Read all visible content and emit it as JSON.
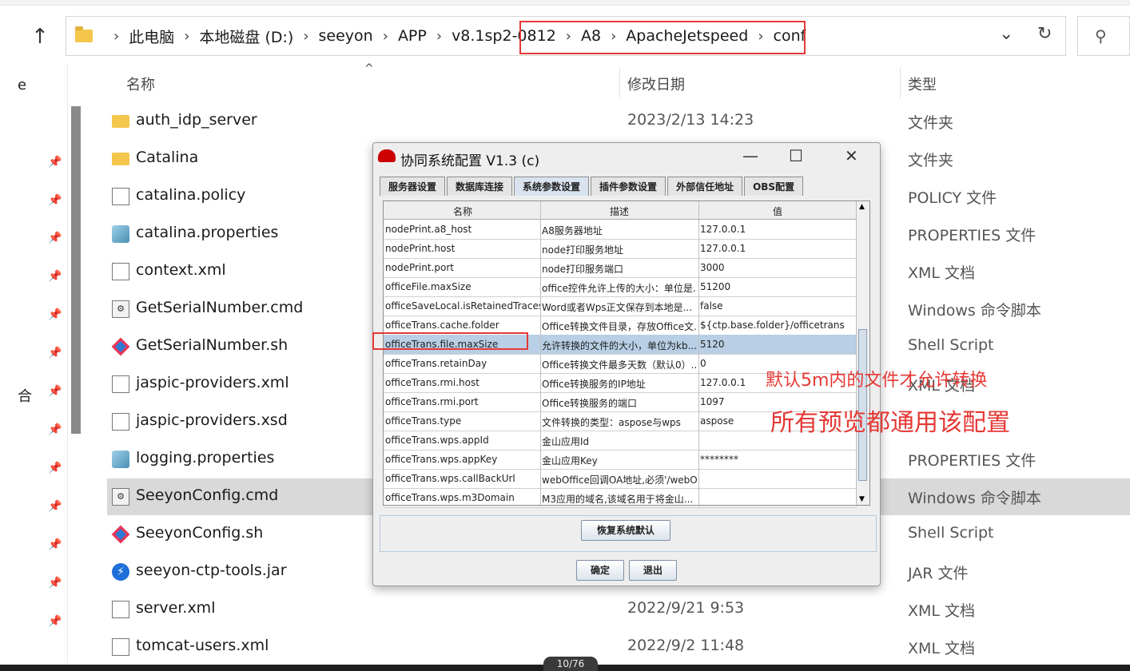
{
  "explorer": {
    "breadcrumbs": [
      "此电脑",
      "本地磁盘 (D:)",
      "seeyon",
      "APP",
      "v8.1sp2-0812",
      "A8",
      "ApacheJetspeed",
      "conf"
    ],
    "left_partial": [
      "e",
      "合"
    ],
    "columns": {
      "name": "名称",
      "date": "修改日期",
      "type": "类型"
    },
    "files": [
      {
        "name": "auth_idp_server",
        "date": "2023/2/13 14:23",
        "type": "文件夹",
        "icon": "folder-icon"
      },
      {
        "name": "Catalina",
        "date": "",
        "type": "文件夹",
        "icon": "folder-icon"
      },
      {
        "name": "catalina.policy",
        "date": "",
        "type": "POLICY 文件",
        "icon": "file-icon"
      },
      {
        "name": "catalina.properties",
        "date": "",
        "type": "PROPERTIES 文件",
        "icon": "properties-file-icon"
      },
      {
        "name": "context.xml",
        "date": "",
        "type": "XML 文档",
        "icon": "file-icon"
      },
      {
        "name": "GetSerialNumber.cmd",
        "date": "",
        "type": "Windows 命令脚本",
        "icon": "cmd-file-icon"
      },
      {
        "name": "GetSerialNumber.sh",
        "date": "",
        "type": "Shell Script",
        "icon": "shell-script-icon"
      },
      {
        "name": "jaspic-providers.xml",
        "date": "",
        "type": "XML 文档",
        "icon": "file-icon"
      },
      {
        "name": "jaspic-providers.xsd",
        "date": "",
        "type": "",
        "icon": "file-icon"
      },
      {
        "name": "logging.properties",
        "date": "",
        "type": "PROPERTIES 文件",
        "icon": "properties-file-icon"
      },
      {
        "name": "SeeyonConfig.cmd",
        "date": "",
        "type": "Windows 命令脚本",
        "icon": "cmd-file-icon",
        "selected": true
      },
      {
        "name": "SeeyonConfig.sh",
        "date": "",
        "type": "Shell Script",
        "icon": "shell-script-icon"
      },
      {
        "name": "seeyon-ctp-tools.jar",
        "date": "",
        "type": "JAR 文件",
        "icon": "jar-file-icon"
      },
      {
        "name": "server.xml",
        "date": "2022/9/21 9:53",
        "type": "XML 文档",
        "icon": "file-icon"
      },
      {
        "name": "tomcat-users.xml",
        "date": "2022/9/2 11:48",
        "type": "XML 文档",
        "icon": "file-icon"
      }
    ]
  },
  "dialog": {
    "title": "协同系统配置 V1.3 (c)",
    "tabs": [
      "服务器设置",
      "数据库连接",
      "系统参数设置",
      "插件参数设置",
      "外部信任地址",
      "OBS配置"
    ],
    "active_tab": "系统参数设置",
    "table_headers": [
      "名称",
      "描述",
      "值"
    ],
    "rows": [
      [
        "nodePrint.a8_host",
        "A8服务器地址",
        "127.0.0.1"
      ],
      [
        "nodePrint.host",
        "node打印服务地址",
        "127.0.0.1"
      ],
      [
        "nodePrint.port",
        "node打印服务端口",
        "3000"
      ],
      [
        "officeFile.maxSize",
        "office控件允许上传的大小：单位是...",
        "51200"
      ],
      [
        "officeSaveLocal.isRetainedTraces",
        "Word或者Wps正文保存到本地是...",
        "false"
      ],
      [
        "officeTrans.cache.folder",
        "Office转换文件目录，存放Office文...",
        "${ctp.base.folder}/officetrans"
      ],
      [
        "officeTrans.file.maxSize",
        "允许转换的文件的大小，单位为kb...",
        "5120"
      ],
      [
        "officeTrans.retainDay",
        "Office转换文件最多天数（默认0）...",
        "0"
      ],
      [
        "officeTrans.rmi.host",
        "Office转换服务的IP地址",
        "127.0.0.1"
      ],
      [
        "officeTrans.rmi.port",
        "Office转换服务的端口",
        "1097"
      ],
      [
        "officeTrans.type",
        "文件转换的类型：aspose与wps",
        "aspose"
      ],
      [
        "officeTrans.wps.appId",
        "金山应用Id",
        ""
      ],
      [
        "officeTrans.wps.appKey",
        "金山应用Key",
        "********"
      ],
      [
        "officeTrans.wps.callBackUrl",
        "webOffice回调OA地址,必须'/webOf...",
        ""
      ],
      [
        "officeTrans.wps.m3Domain",
        "M3应用的域名,该域名用于将金山...",
        ""
      ]
    ],
    "selected_row": 6,
    "restore_button": "恢复系统默认",
    "ok_button": "确定",
    "exit_button": "退出"
  },
  "annotations": {
    "line1": "默认5m内的文件才允许转换",
    "line2": "所有预览都通用该配置"
  },
  "page_indicator": "10/76",
  "colors": {
    "annotation": "#e53935",
    "selected_row": "#d9d9d9",
    "table_selected": "#b8cfe5"
  }
}
